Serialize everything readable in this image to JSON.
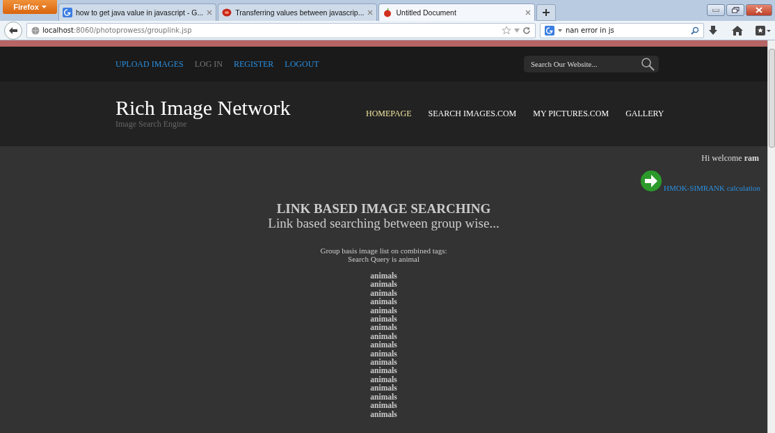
{
  "browser": {
    "menu_button": "Firefox",
    "tabs": [
      {
        "title": "how to get java value in javascript - G...",
        "selected": false,
        "kind": "google"
      },
      {
        "title": "Transferring values between javascrip...",
        "selected": false,
        "kind": "red"
      },
      {
        "title": "Untitled Document",
        "selected": true,
        "kind": "apple"
      }
    ],
    "url_host": "localhost",
    "url_path": ":8060/photoprowess/grouplink.jsp",
    "search_value": "nan error in js"
  },
  "topbar": {
    "links": [
      {
        "label": "UPLOAD IMAGES",
        "disabled": false
      },
      {
        "label": "LOG IN",
        "disabled": true
      },
      {
        "label": "REGISTER",
        "disabled": false
      },
      {
        "label": "LOGOUT",
        "disabled": false
      }
    ],
    "search": {
      "placeholder": "Search Our Website..."
    }
  },
  "header": {
    "site_title": "Rich Image Network",
    "tagline": "Image Search Engine",
    "nav": [
      {
        "label": "HOMEPAGE",
        "selected": true
      },
      {
        "label": "SEARCH IMAGES.COM",
        "selected": false
      },
      {
        "label": "MY PICTURES.COM",
        "selected": false
      },
      {
        "label": "GALLERY",
        "selected": false
      }
    ]
  },
  "content": {
    "welcome": "Hi welcome **ram**",
    "action_link": "HMOK-SIMRANK calculation",
    "heading": "LINK BASED IMAGE SEARCHING",
    "subheading": "Link based searching between group wise...",
    "caption": "Group basis image list on combined tags:",
    "query": "Search Query is animal",
    "results": [
      "animals",
      "animals",
      "animals",
      "animals",
      "animals",
      "animals",
      "animals",
      "animals",
      "animals",
      "animals",
      "animals",
      "animals",
      "animals",
      "animals",
      "animals",
      "animals",
      "animals"
    ]
  }
}
